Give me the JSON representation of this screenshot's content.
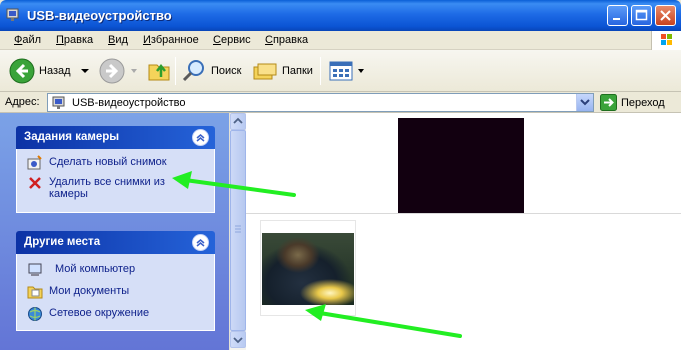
{
  "window": {
    "title": "USB-видеоустройство"
  },
  "menu": {
    "items": [
      {
        "label": "Файл",
        "accel": "Ф",
        "rest": "айл"
      },
      {
        "label": "Правка",
        "accel": "П",
        "rest": "равка"
      },
      {
        "label": "Вид",
        "accel": "В",
        "rest": "ид"
      },
      {
        "label": "Избранное",
        "accel": "И",
        "rest": "збранное"
      },
      {
        "label": "Сервис",
        "accel": "С",
        "rest": "ервис"
      },
      {
        "label": "Справка",
        "accel": "С",
        "rest": "правка"
      }
    ]
  },
  "toolbar": {
    "back_label": "Назад",
    "search_label": "Поиск",
    "folders_label": "Папки"
  },
  "address": {
    "label": "Адрес:",
    "value": "USB-видеоустройство",
    "go_label": "Переход"
  },
  "tasks": {
    "camera_title": "Задания камеры",
    "take_picture": "Сделать новый снимок",
    "delete_all": "Удалить все снимки из камеры",
    "places_title": "Другие места",
    "my_computer": "Мой компьютер",
    "my_documents": "Мои документы",
    "network": "Сетевое окружение"
  },
  "colors": {
    "title_blue": "#0b54d4",
    "pane_blue": "#6375d6",
    "arrow_green": "#22ee22",
    "task_link": "#0c1f8a"
  }
}
